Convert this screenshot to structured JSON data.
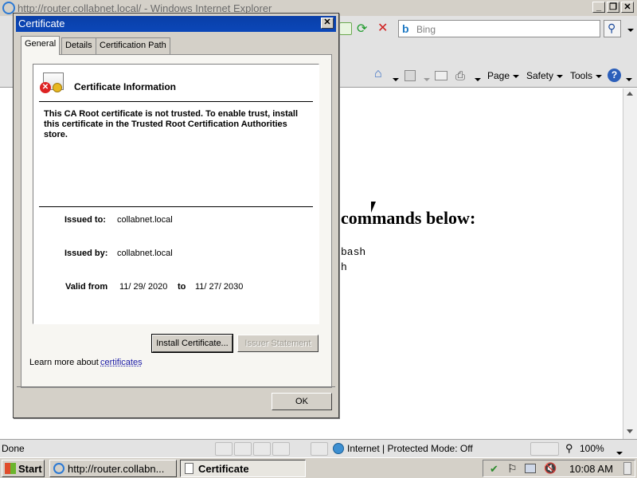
{
  "browser": {
    "title": "http://router.collabnet.local/ - Windows Internet Explorer",
    "search_placeholder": "Bing",
    "toolbar": {
      "page": "Page",
      "safety": "Safety",
      "tools": "Tools"
    }
  },
  "page": {
    "heading_fragment": "commands below:",
    "code_line1": "bash",
    "code_line2": "h"
  },
  "dialog": {
    "title": "Certificate",
    "tabs": [
      "General",
      "Details",
      "Certification Path"
    ],
    "info_heading": "Certificate Information",
    "warning": "This CA Root certificate is not trusted. To enable trust, install this certificate in the Trusted Root Certification Authorities store.",
    "issued_to_label": "Issued to:",
    "issued_to": "collabnet.local",
    "issued_by_label": "Issued by:",
    "issued_by": "collabnet.local",
    "valid_from_label": "Valid from",
    "valid_from": "11/ 29/ 2020",
    "valid_to_label": "to",
    "valid_to": "11/ 27/ 2030",
    "install_button": "Install Certificate...",
    "issuer_statement_button": "Issuer Statement",
    "learn_more_prefix": "Learn more about",
    "learn_more_link": "certificates",
    "ok_button": "OK"
  },
  "status": {
    "left": "Done",
    "zone": "Internet | Protected Mode: Off",
    "zoom": "100%"
  },
  "taskbar": {
    "start": "Start",
    "task_ie": "http://router.collabn...",
    "task_cert": "Certificate",
    "clock": "10:08 AM"
  }
}
